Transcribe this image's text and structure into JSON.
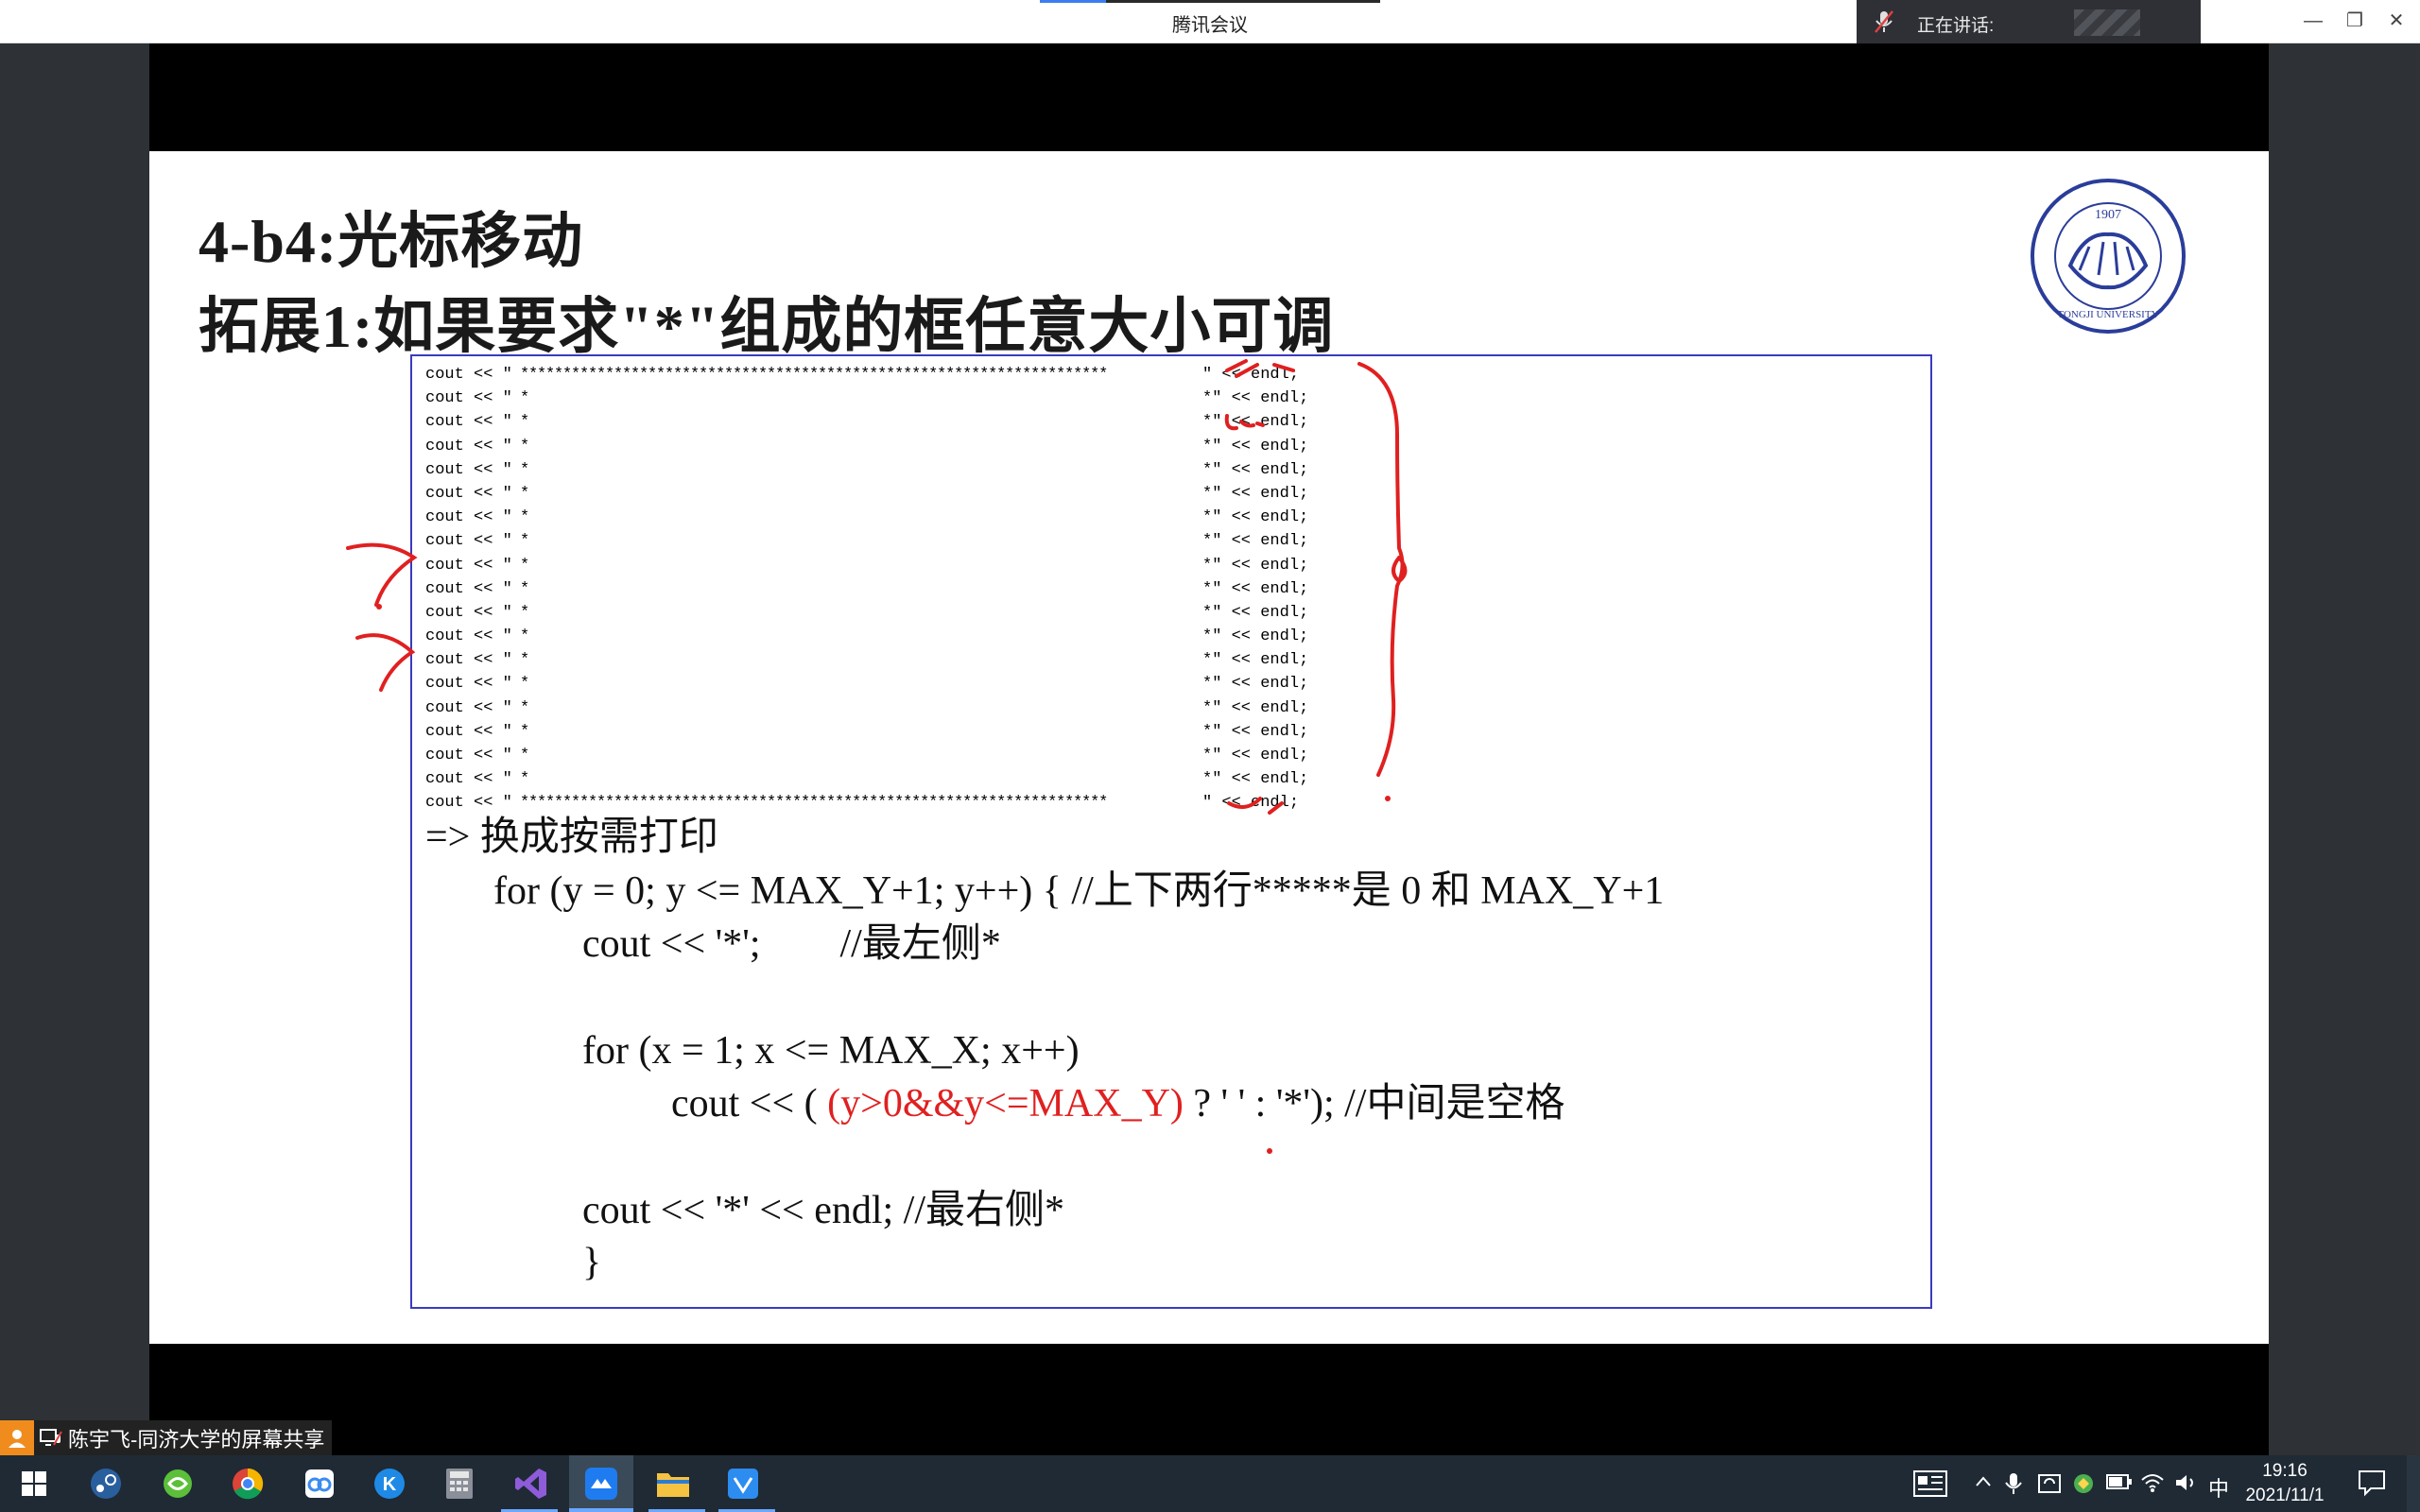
{
  "titlebar": {
    "title": "腾讯会议",
    "speaking_label": "正在讲话:",
    "minimize": "—",
    "restore": "❐",
    "close": "✕"
  },
  "slide": {
    "title_line1": "4-b4:光标移动",
    "title_line2": "拓展1:如果要求\"*\"组成的框任意大小可调",
    "logo_year": "1907",
    "logo_text": "TONGJI UNIVERSITY",
    "small_code": {
      "prefix": "cout << \"",
      "top_row": "*********************************************************************",
      "middle_row": "*                                                                   *",
      "suffix": "\" << endl;",
      "line_count": 19
    },
    "big_code": {
      "l1": "=> 换成按需打印",
      "l2": "for (y = 0; y <= MAX_Y+1; y++) { //上下两行*****是 0 和 MAX_Y+1",
      "l3": "cout << '*';        //最左侧*",
      "l4": "for (x = 1; x <= MAX_X; x++)",
      "l5a": "cout << ( ",
      "l5_red": "(y>0&&y<=MAX_Y)",
      "l5b": " ? ' ' : '*'); //中间是空格",
      "l6": "cout << '*' << endl; //最右侧*",
      "l7": "}"
    }
  },
  "share_label": "陈宇飞-同济大学的屏幕共享",
  "taskbar": {
    "ime": "中",
    "time": "19:16",
    "date": "2021/11/1"
  },
  "colors": {
    "accent": "#3c7df0",
    "annotation": "#e02020",
    "box_border": "#3a3ac0"
  }
}
